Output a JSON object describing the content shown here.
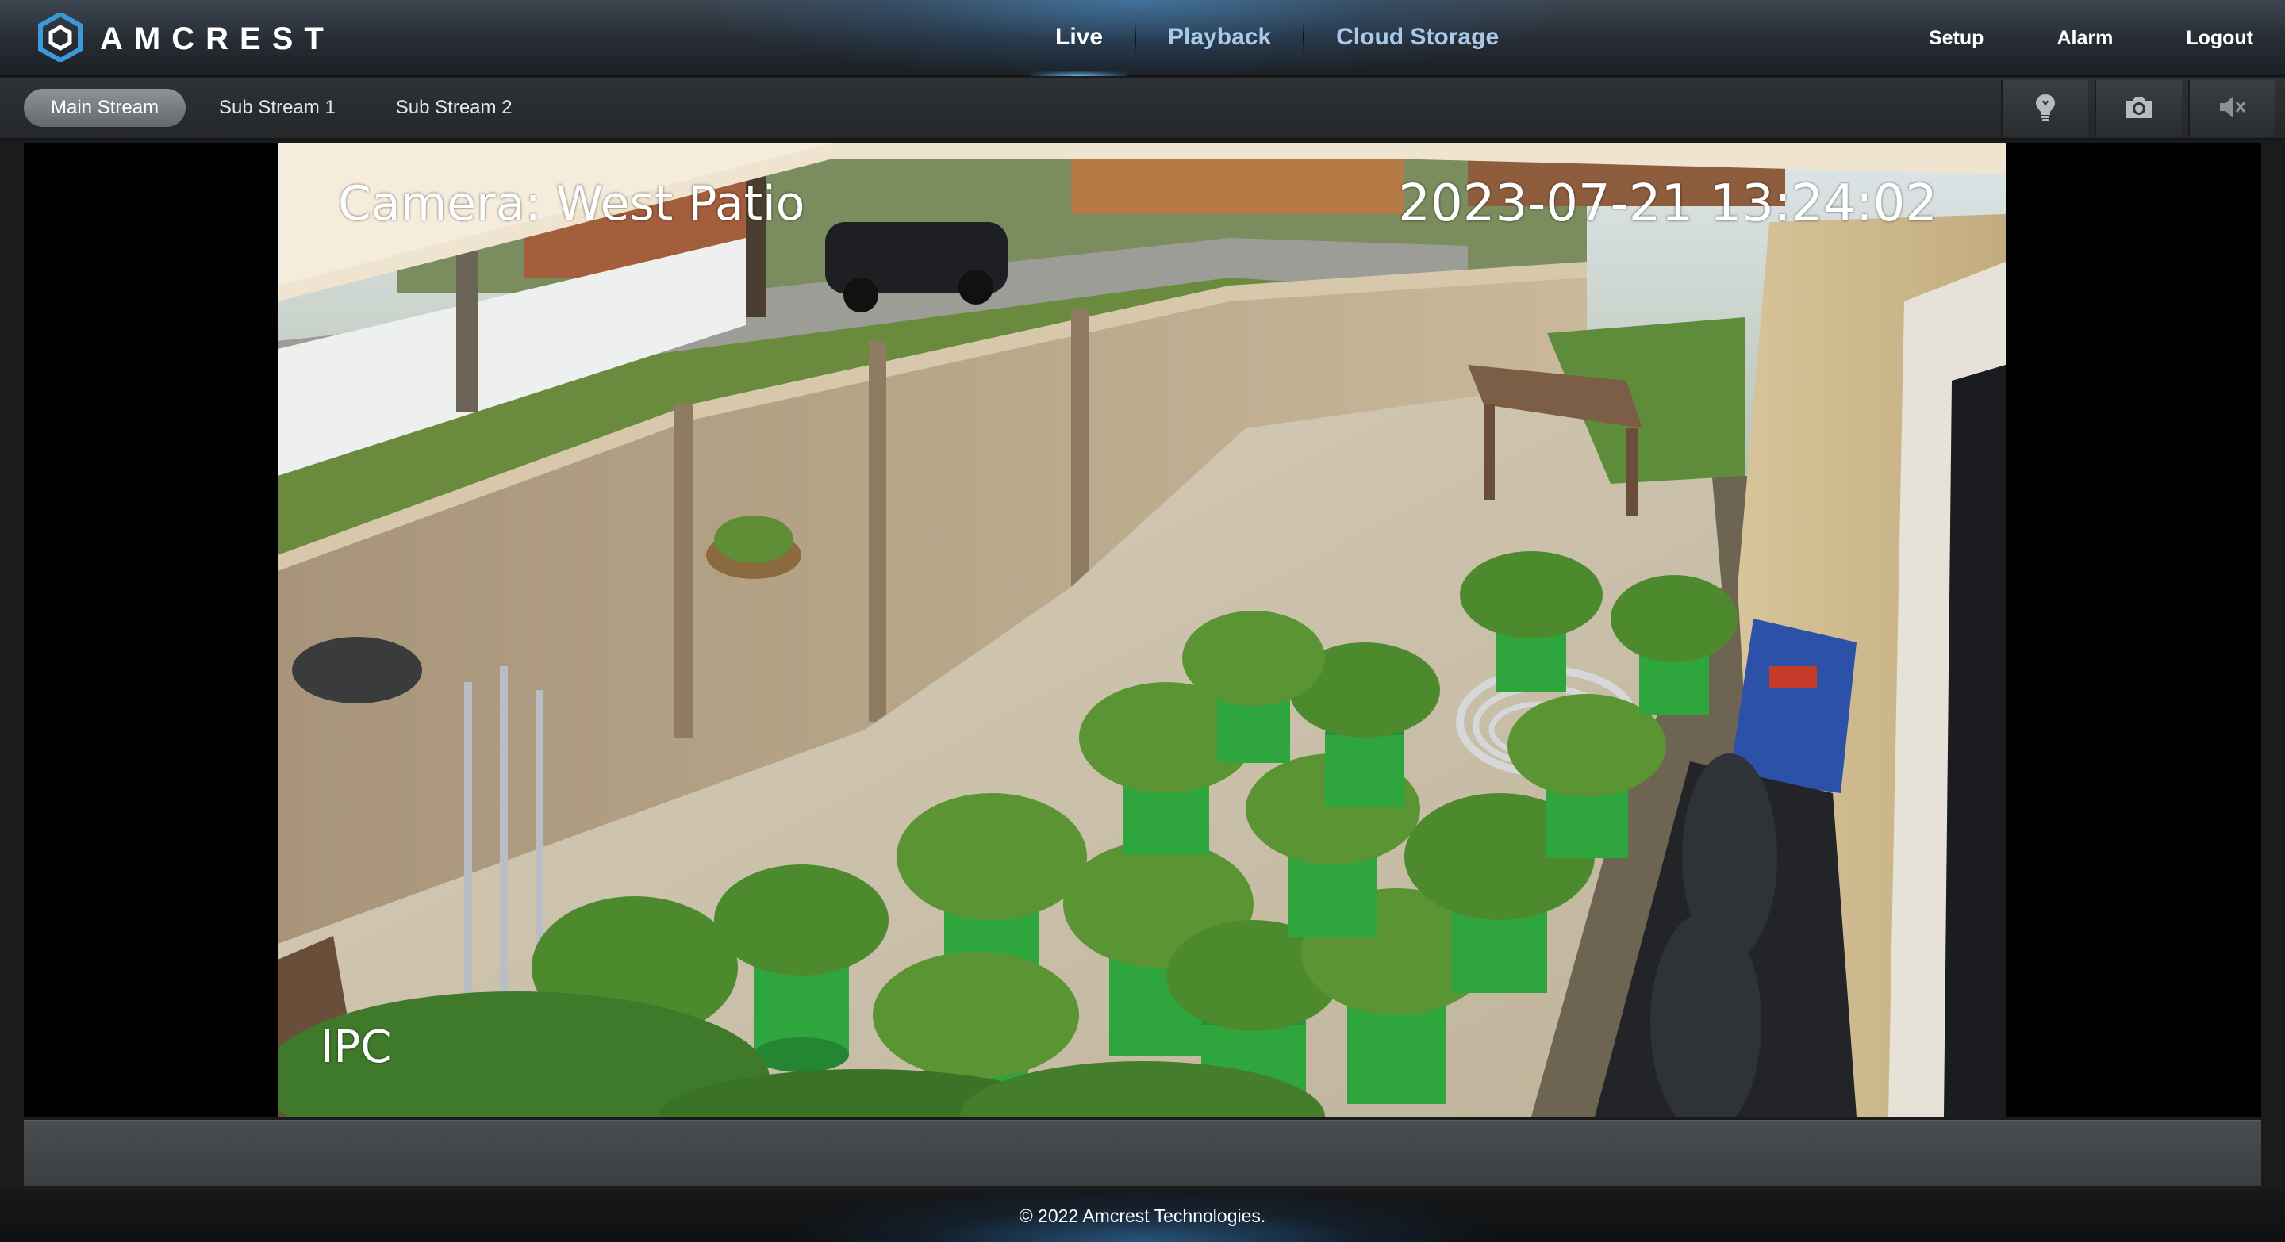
{
  "brand": {
    "logo_text": "AMCREST",
    "logo_icon": "amcrest-hexagon-logo",
    "accent_color": "#3a9ad9"
  },
  "main_nav": [
    {
      "label": "Live",
      "active": true
    },
    {
      "label": "Playback",
      "active": false
    },
    {
      "label": "Cloud Storage",
      "active": false
    }
  ],
  "right_nav": [
    {
      "label": "Setup"
    },
    {
      "label": "Alarm"
    },
    {
      "label": "Logout"
    }
  ],
  "stream_tabs": [
    {
      "label": "Main Stream",
      "active": true
    },
    {
      "label": "Sub Stream 1",
      "active": false
    },
    {
      "label": "Sub Stream 2",
      "active": false
    }
  ],
  "toolbar_icons": [
    "light-bulb-icon",
    "camera-snapshot-icon",
    "speaker-muted-icon"
  ],
  "video": {
    "osd_camera": "Camera: West Patio",
    "osd_timestamp": "2023-07-21 13:24:02",
    "osd_corner": "IPC"
  },
  "footer": {
    "copyright": "© 2022 Amcrest Technologies."
  }
}
